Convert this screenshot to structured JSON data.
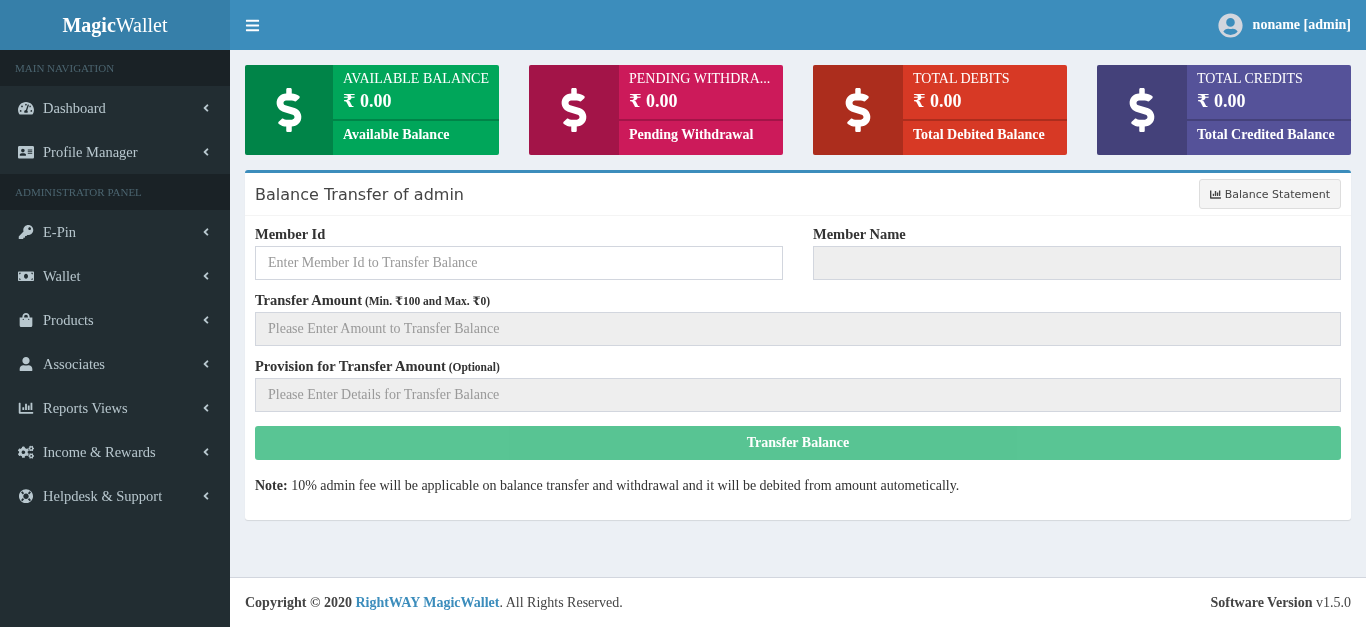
{
  "brand": "**Magic**Wallet",
  "user": {
    "name": "noname [admin]"
  },
  "sidebar": {
    "sections": [
      {
        "header": "MAIN NAVIGATION",
        "items": [
          {
            "kind": "dashboard",
            "label": "Dashboard"
          },
          {
            "kind": "profile",
            "label": "Profile Manager"
          }
        ]
      },
      {
        "header": "ADMINISTRATOR PANEL",
        "items": [
          {
            "kind": "epin",
            "label": "E-Pin"
          },
          {
            "kind": "wallet",
            "label": "Wallet"
          },
          {
            "kind": "products",
            "label": "Products"
          },
          {
            "kind": "associates",
            "label": "Associates"
          },
          {
            "kind": "reports",
            "label": "Reports Views"
          },
          {
            "kind": "income",
            "label": "Income & Rewards"
          },
          {
            "kind": "helpdesk",
            "label": "Helpdesk & Support"
          }
        ]
      }
    ]
  },
  "info_boxes": [
    {
      "title": "AVAILABLE BALANCE",
      "amount": "₹ 0.00",
      "description": "Available Balance",
      "color": "#00a65a"
    },
    {
      "title": "PENDING WITHDRA...",
      "amount": "₹ 0.00",
      "description": "Pending Withdrawal",
      "color": "#cc1a5a"
    },
    {
      "title": "TOTAL DEBITS",
      "amount": "₹ 0.00",
      "description": "Total Debited Balance",
      "color": "#d73925"
    },
    {
      "title": "TOTAL CREDITS",
      "amount": "₹ 0.00",
      "description": "Total Credited Balance",
      "color": "#555299"
    }
  ],
  "form": {
    "title": "Balance Transfer of admin",
    "statement_button": "Balance Statement",
    "fields": [
      {
        "label": "Member Id",
        "placeholder": "Enter Member Id to Transfer Balance",
        "disabled": false
      },
      {
        "label": "Member Name",
        "disabled": true
      },
      {
        "label": "Transfer Amount",
        "hint": "(Min. ₹100 and Max. ₹0)",
        "placeholder": "Please Enter Amount to Transfer Balance",
        "disabled": true
      },
      {
        "label": "Provision for Transfer Amount",
        "hint": "(Optional)",
        "placeholder": "Please Enter Details for Transfer Balance",
        "disabled": true
      }
    ],
    "submit": {
      "label": "Transfer Balance",
      "disabled": true
    },
    "note": "**Note:** 10% admin fee will be applicable on balance transfer and withdrawal and it will be debited from amount autometically."
  },
  "footer": {
    "copyright": "Copyright © 2020",
    "link": "RightWAY MagicWallet",
    "suffix": ". All Rights Reserved.",
    "version_label": "Software Version",
    "version": "v1.5.0"
  }
}
